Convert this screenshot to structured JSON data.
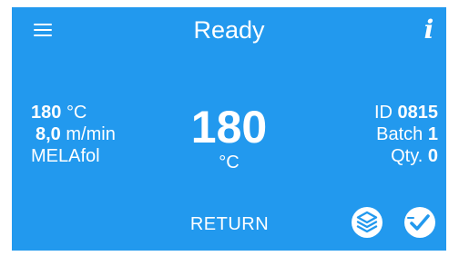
{
  "header": {
    "title": "Ready",
    "menu_icon": "hamburger-menu-icon",
    "info_icon": "info-icon",
    "info_glyph": "i"
  },
  "left_panel": {
    "temperature_value": "180",
    "temperature_unit": "°C",
    "speed_value": "8,0",
    "speed_unit": "m/min",
    "material": "MELAfol"
  },
  "center": {
    "temperature_value": "180",
    "temperature_unit": "°C"
  },
  "right_panel": {
    "id_label": "ID",
    "id_value": "0815",
    "batch_label": "Batch",
    "batch_value": "1",
    "qty_label": "Qty.",
    "qty_value": "0"
  },
  "footer": {
    "return_label": "RETURN",
    "layers_icon": "layers-icon",
    "checklist_icon": "check-badge-icon"
  },
  "colors": {
    "background": "#2299ee",
    "foreground": "#ffffff"
  }
}
